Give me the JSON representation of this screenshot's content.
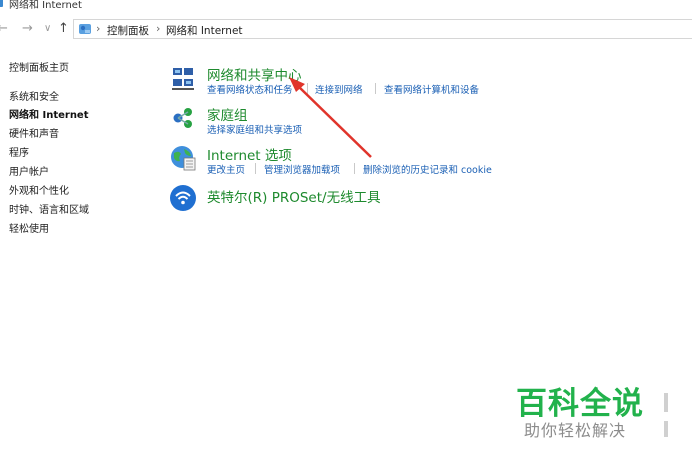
{
  "window": {
    "title": "网络和 Internet"
  },
  "nav": {
    "back": "←",
    "forward": "→",
    "dropdown": "∨",
    "up": "↑",
    "separator": "›"
  },
  "address": {
    "crumbs": [
      "控制面板",
      "网络和 Internet"
    ]
  },
  "sidebar": {
    "items": [
      {
        "label": "控制面板主页"
      },
      {
        "label": "系统和安全"
      },
      {
        "label": "网络和 Internet"
      },
      {
        "label": "硬件和声音"
      },
      {
        "label": "程序"
      },
      {
        "label": "用户帐户"
      },
      {
        "label": "外观和个性化"
      },
      {
        "label": "时钟、语言和区域"
      },
      {
        "label": "轻松使用"
      }
    ],
    "active": "网络和 Internet"
  },
  "sections": [
    {
      "title": "网络和共享中心",
      "icon": "network-sharing-icon",
      "links": [
        "查看网络状态和任务",
        "连接到网络",
        "查看网络计算机和设备"
      ]
    },
    {
      "title": "家庭组",
      "icon": "homegroup-icon",
      "links": [
        "选择家庭组和共享选项"
      ]
    },
    {
      "title": "Internet 选项",
      "icon": "internet-options-icon",
      "links": [
        "更改主页",
        "管理浏览器加载项",
        "删除浏览的历史记录和 cookie"
      ]
    },
    {
      "title": "英特尔(R) PROSet/无线工具",
      "icon": "wireless-icon",
      "links": []
    }
  ],
  "watermark": {
    "main": "百科全说",
    "sub": "助你轻松解决"
  },
  "colors": {
    "accent_title": "#1e8a2e",
    "link": "#1a5fb4",
    "arrow": "#e0342b",
    "watermark": "#22b24c"
  }
}
